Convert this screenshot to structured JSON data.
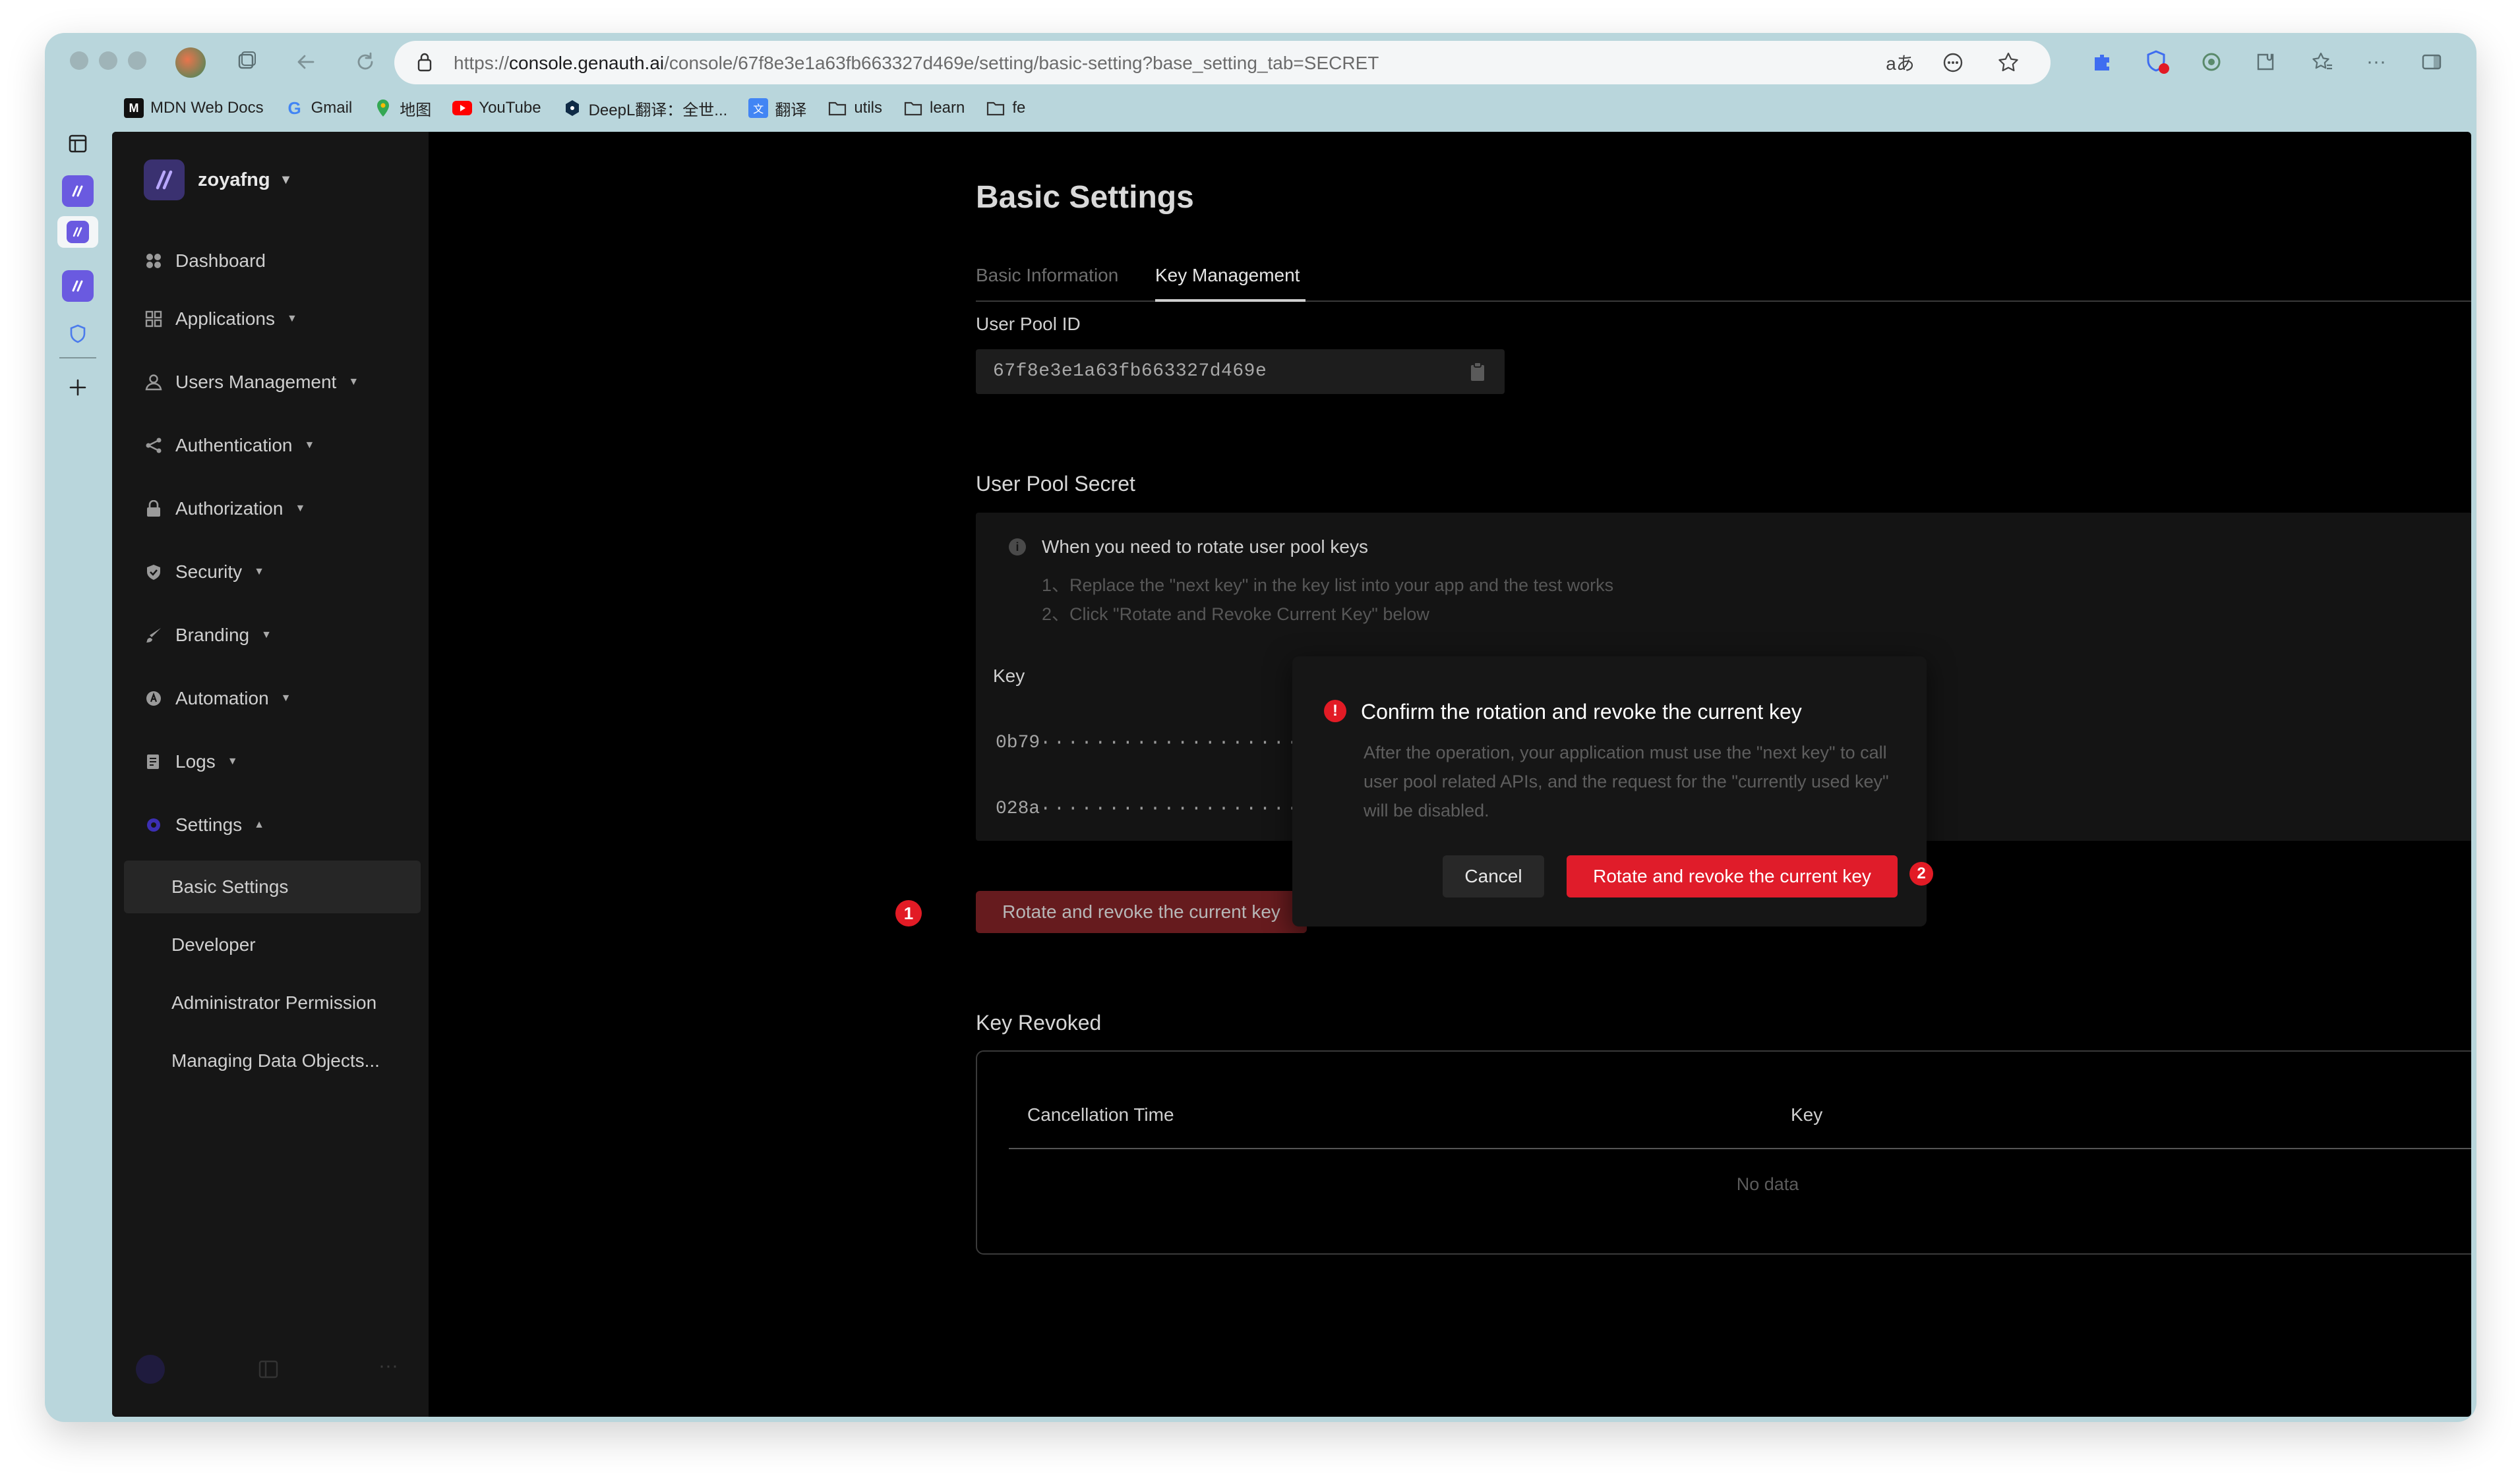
{
  "browser": {
    "url_scheme": "https://",
    "url_host": "console.genauth.ai",
    "url_path": "/console/67f8e3e1a63fb663327d469e/setting/basic-setting?base_setting_tab=SECRET",
    "bookmarks": [
      {
        "label": "MDN Web Docs",
        "icon": "mdn-icon"
      },
      {
        "label": "Gmail",
        "icon": "google-icon"
      },
      {
        "label": "地图",
        "icon": "map-pin-icon"
      },
      {
        "label": "YouTube",
        "icon": "youtube-icon"
      },
      {
        "label": "DeepL翻译：全世...",
        "icon": "deepl-icon"
      },
      {
        "label": "翻译",
        "icon": "translate-icon"
      },
      {
        "label": "utils",
        "icon": "folder-icon"
      },
      {
        "label": "learn",
        "icon": "folder-icon"
      },
      {
        "label": "fe",
        "icon": "folder-icon"
      }
    ],
    "colors": {
      "window": "#b9d6dc",
      "urlbar": "#f4f6f7"
    }
  },
  "sidebar": {
    "org_name": "zoyafng",
    "items": [
      {
        "label": "Dashboard",
        "icon": "dashboard-icon"
      },
      {
        "label": "Applications",
        "icon": "apps-icon"
      },
      {
        "label": "Users Management",
        "icon": "user-icon"
      },
      {
        "label": "Authentication",
        "icon": "share-icon"
      },
      {
        "label": "Authorization",
        "icon": "lock-icon"
      },
      {
        "label": "Security",
        "icon": "shield-icon"
      },
      {
        "label": "Branding",
        "icon": "brush-icon"
      },
      {
        "label": "Automation",
        "icon": "automation-icon"
      },
      {
        "label": "Logs",
        "icon": "logs-icon"
      },
      {
        "label": "Settings",
        "icon": "settings-icon"
      }
    ],
    "sub_items": [
      {
        "label": "Basic Settings"
      },
      {
        "label": "Developer"
      },
      {
        "label": "Administrator Permission"
      },
      {
        "label": "Managing Data Objects..."
      }
    ]
  },
  "main": {
    "title": "Basic Settings",
    "tabs": [
      {
        "label": "Basic Information"
      },
      {
        "label": "Key Management"
      }
    ],
    "user_pool_id_label": "User Pool ID",
    "user_pool_id": "67f8e3e1a63fb663327d469e",
    "secret_section": "User Pool Secret",
    "alert": {
      "title": "When you need to rotate user pool keys",
      "line1": "1、Replace the \"next key\" in the key list into your app and the test works",
      "line2": "2、Click \"Rotate and Revoke Current Key\" below"
    },
    "key_header": "Key",
    "keys": [
      {
        "prefix": "0b79",
        "mask": "······················"
      },
      {
        "prefix": "028a",
        "mask": "······················"
      }
    ],
    "rotate_button": "Rotate and revoke the current key",
    "revoked_section": "Key Revoked",
    "revoked_table": {
      "col1": "Cancellation Time",
      "col2": "Key",
      "empty": "No data"
    }
  },
  "modal": {
    "title": "Confirm the rotation and revoke the current key",
    "body": "After the operation, your application must use the \"next key\" to call user pool related APIs, and the request for the \"currently used key\" will be disabled.",
    "cancel": "Cancel",
    "confirm": "Rotate and revoke the current key"
  },
  "markers": {
    "one": "1",
    "two": "2"
  },
  "colors": {
    "accent_red": "#e01c2a",
    "app_bg": "#000000",
    "sidebar_bg": "#161616"
  }
}
